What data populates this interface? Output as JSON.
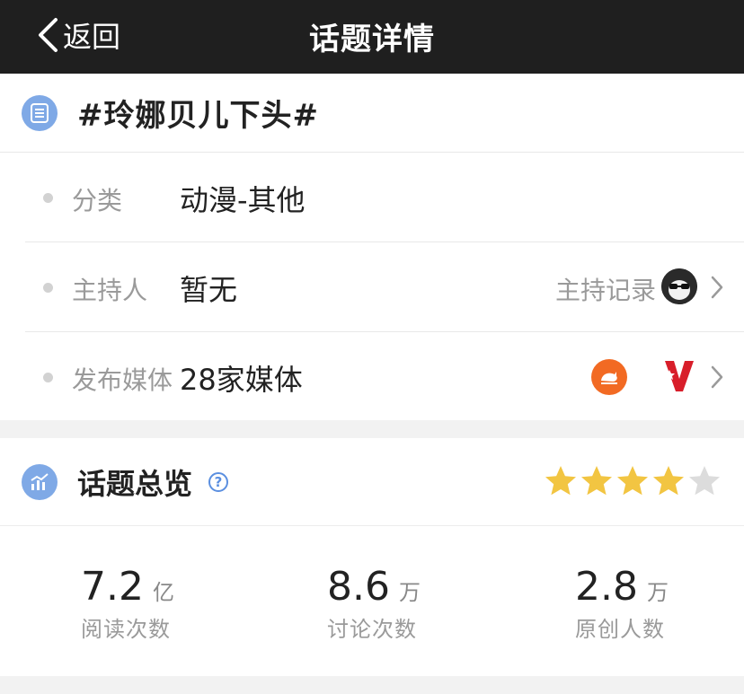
{
  "nav": {
    "back_label": "返回",
    "title": "话题详情"
  },
  "topic": {
    "name": "#玲娜贝儿下头#"
  },
  "rows": {
    "category": {
      "label": "分类",
      "value": "动漫-其他"
    },
    "host": {
      "label": "主持人",
      "value": "暂无",
      "record_label": "主持记录"
    },
    "media": {
      "label": "发布媒体",
      "value": "28家媒体"
    }
  },
  "overview": {
    "title": "话题总览",
    "rating": 4,
    "rating_max": 5,
    "stats": [
      {
        "number": "7.2",
        "unit": "亿",
        "label": "阅读次数"
      },
      {
        "number": "8.6",
        "unit": "万",
        "label": "讨论次数"
      },
      {
        "number": "2.8",
        "unit": "万",
        "label": "原创人数"
      }
    ]
  },
  "colors": {
    "nav_bg": "#1f1f1f",
    "accent_blue": "#7fa9e6",
    "star_filled": "#f2c542",
    "star_empty": "#dcdcdc",
    "media_orange": "#f26a23",
    "media_red": "#d81e2a"
  },
  "icons": {
    "back": "chevron-left-icon",
    "topic": "list-icon",
    "overview": "bar-chart-icon",
    "help": "question-circle-icon",
    "chevron": "chevron-right-icon"
  }
}
